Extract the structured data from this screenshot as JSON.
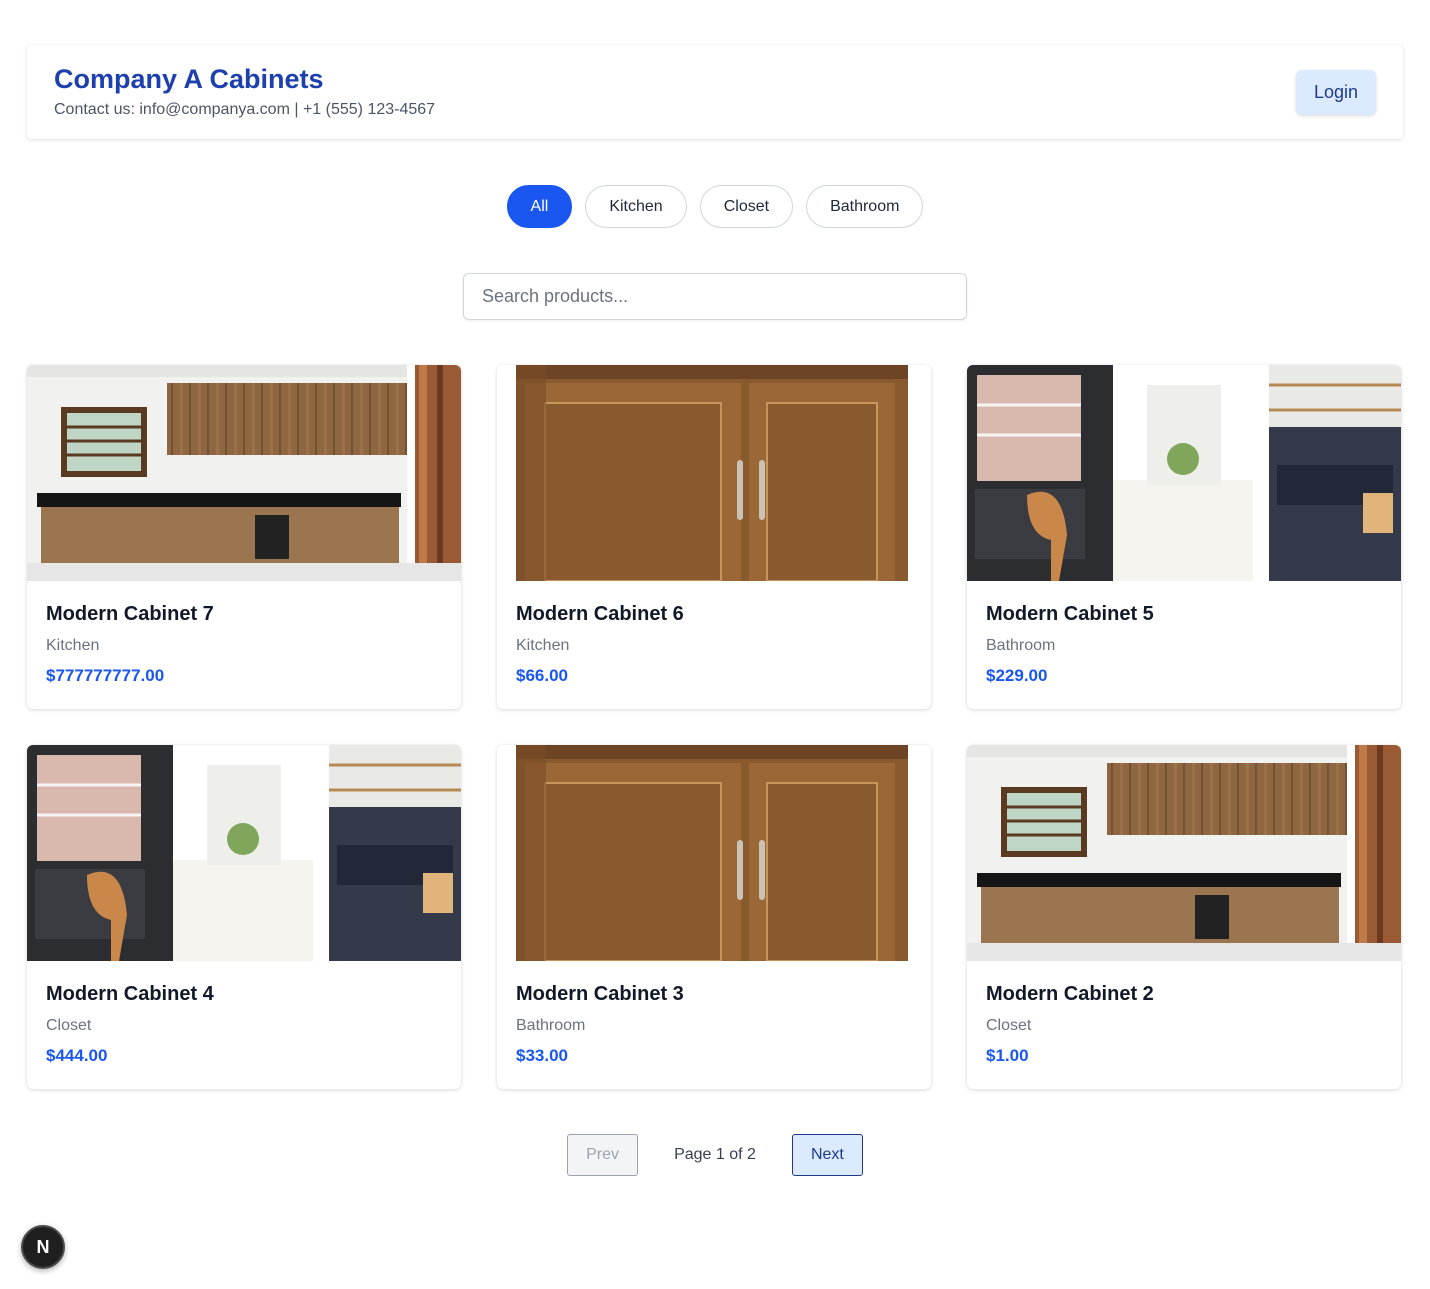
{
  "header": {
    "title": "Company A Cabinets",
    "contact": "Contact us: info@companya.com | +1 (555) 123-4567",
    "login_label": "Login"
  },
  "filters": [
    {
      "label": "All",
      "active": true
    },
    {
      "label": "Kitchen",
      "active": false
    },
    {
      "label": "Closet",
      "active": false
    },
    {
      "label": "Bathroom",
      "active": false
    }
  ],
  "search": {
    "placeholder": "Search products...",
    "value": ""
  },
  "products": [
    {
      "name": "Modern Cabinet 7",
      "category": "Kitchen",
      "price": "$777777777.00",
      "image": "kitchen-photo"
    },
    {
      "name": "Modern Cabinet 6",
      "category": "Kitchen",
      "price": "$66.00",
      "image": "wood-doors-photo"
    },
    {
      "name": "Modern Cabinet 5",
      "category": "Bathroom",
      "price": "$229.00",
      "image": "pantry-collage-photo"
    },
    {
      "name": "Modern Cabinet 4",
      "category": "Closet",
      "price": "$444.00",
      "image": "pantry-collage-photo"
    },
    {
      "name": "Modern Cabinet 3",
      "category": "Bathroom",
      "price": "$33.00",
      "image": "wood-doors-photo"
    },
    {
      "name": "Modern Cabinet 2",
      "category": "Closet",
      "price": "$1.00",
      "image": "kitchen-photo"
    }
  ],
  "pagination": {
    "prev_label": "Prev",
    "next_label": "Next",
    "info": "Page 1 of 2"
  },
  "badge": {
    "label": "N"
  }
}
